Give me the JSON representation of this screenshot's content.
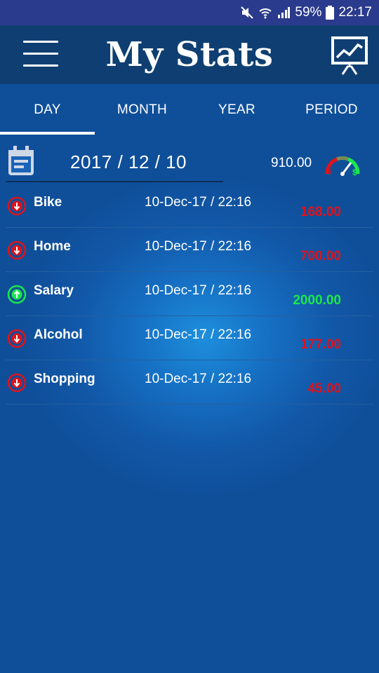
{
  "status_bar": {
    "battery_percent": "59%",
    "time": "22:17",
    "icons": [
      "mute-icon",
      "wifi-icon",
      "signal-icon",
      "battery-icon"
    ]
  },
  "app_bar": {
    "title": "My Stats",
    "icons": [
      "menu-icon",
      "presentation-chart-icon"
    ]
  },
  "tabs": [
    {
      "label": "DAY",
      "selected": true
    },
    {
      "label": "MONTH",
      "selected": false
    },
    {
      "label": "YEAR",
      "selected": false
    },
    {
      "label": "PERIOD",
      "selected": false
    }
  ],
  "date_bar": {
    "date": "2017 / 12 / 10",
    "balance": "910.00",
    "icons": [
      "calendar-icon",
      "gauge-icon"
    ]
  },
  "transactions": [
    {
      "name": "Bike",
      "datetime": "10-Dec-17 / 22:16",
      "amount": "168.00",
      "type": "expense",
      "icon": "arrow-down-circle-icon"
    },
    {
      "name": "Home",
      "datetime": "10-Dec-17 / 22:16",
      "amount": "700.00",
      "type": "expense",
      "icon": "arrow-down-circle-icon"
    },
    {
      "name": "Salary",
      "datetime": "10-Dec-17 / 22:16",
      "amount": "2000.00",
      "type": "income",
      "icon": "arrow-up-circle-icon"
    },
    {
      "name": "Alcohol",
      "datetime": "10-Dec-17 / 22:16",
      "amount": "177.00",
      "type": "expense",
      "icon": "arrow-down-circle-icon"
    },
    {
      "name": "Shopping",
      "datetime": "10-Dec-17 / 22:16",
      "amount": "45.00",
      "type": "expense",
      "icon": "arrow-down-circle-icon"
    }
  ],
  "colors": {
    "expense": "#e0121a",
    "income": "#19e84a",
    "app_bar": "#0f3f72",
    "status_bar": "#2a3a8c"
  }
}
